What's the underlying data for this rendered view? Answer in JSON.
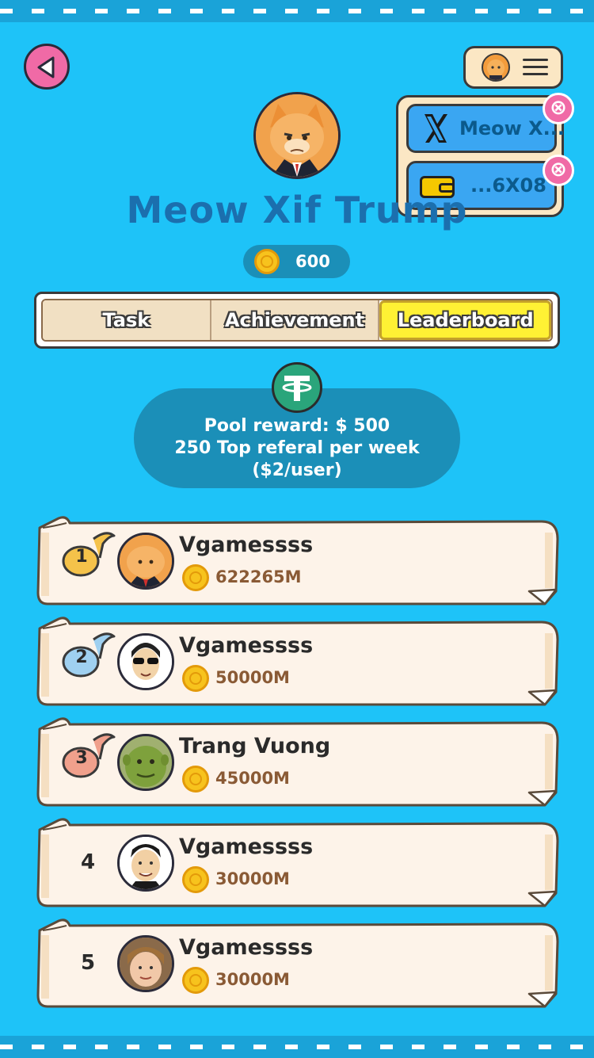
{
  "header": {
    "back_icon": "back-triangle-icon",
    "menu_icon": "hamburger-menu-icon"
  },
  "dropdown": {
    "items": [
      {
        "label": "Meow X...",
        "icon": "x-logo-icon"
      },
      {
        "label": "...6X08",
        "icon": "wallet-icon"
      }
    ],
    "close_glyph": "⊗"
  },
  "profile": {
    "name": "Meow Xif Trump",
    "coins": "600"
  },
  "tabs": [
    {
      "label": "Task",
      "active": false
    },
    {
      "label": "Achievement",
      "active": false
    },
    {
      "label": "Leaderboard",
      "active": true
    }
  ],
  "reward": {
    "line1": "Pool reward: $ 500",
    "line2": "250 Top referal per week",
    "line3": "($2/user)"
  },
  "leaderboard": [
    {
      "rank": "1",
      "name": "Vgamessss",
      "score": "622265M",
      "badge_color": "#f5c24a"
    },
    {
      "rank": "2",
      "name": "Vgamessss",
      "score": "50000M",
      "badge_color": "#9fd0f0"
    },
    {
      "rank": "3",
      "name": "Trang Vuong",
      "score": "45000M",
      "badge_color": "#f0a08c"
    },
    {
      "rank": "4",
      "name": "Vgamessss",
      "score": "30000M"
    },
    {
      "rank": "5",
      "name": "Vgamessss",
      "score": "30000M"
    }
  ],
  "colors": {
    "background": "#1ec3f8",
    "accent_pink": "#f06aa6",
    "active_tab": "#fff134",
    "paper": "#fdf3e9"
  }
}
